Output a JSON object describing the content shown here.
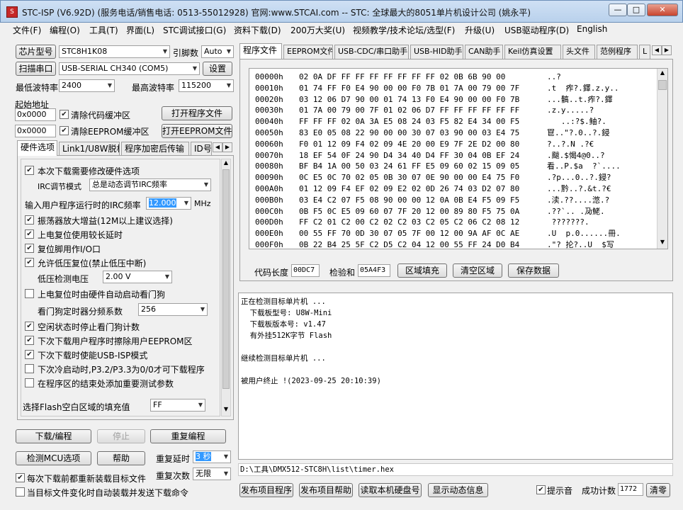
{
  "title": "STC-ISP (V6.92D) (服务电话/销售电话: 0513-55012928) 官网:www.STCAI.com  -- STC: 全球最大的8051单片机设计公司 (姚永平)",
  "window_buttons": {
    "minimize": "—",
    "maximize": "□",
    "close": "✕"
  },
  "menu": [
    "文件(F)",
    "编程(O)",
    "工具(T)",
    "界面(L)",
    "STC调试接口(G)",
    "资料下载(D)",
    "200万大奖(U)",
    "视频教学/技术论坛/选型(F)",
    "升级(U)",
    "USB驱动程序(D)",
    "English"
  ],
  "left": {
    "chip_btn": "芯片型号",
    "chip_value": "STC8H1K08",
    "pins_label": "引脚数",
    "pins_value": "Auto",
    "scan_btn": "扫描串口",
    "port_value": "USB-SERIAL CH340 (COM5)",
    "settings_btn": "设置",
    "min_baud_label": "最低波特率",
    "min_baud": "2400",
    "max_baud_label": "最高波特率",
    "max_baud": "115200",
    "start_addr_label": "起始地址",
    "addr1": "0x0000",
    "clear_code": "清除代码缓冲区",
    "open_prog": "打开程序文件",
    "addr2": "0x0000",
    "clear_eeprom": "清除EEPROM缓冲区",
    "open_eeprom": "打开EEPROM文件",
    "tabs": [
      "硬件选项",
      "Link1/U8W脱机",
      "程序加密后传输",
      "ID号"
    ],
    "hw": {
      "opt1": "本次下载需要修改硬件选项",
      "irc_mode_label": "IRC调节模式",
      "irc_mode": "总是动态调节IRC频率",
      "irc_freq_label": "输入用户程序运行时的IRC频率",
      "irc_freq": "12.000",
      "mhz": "MHz",
      "opt2": "振荡器放大增益(12M以上建议选择)",
      "opt3": "上电复位使用较长延时",
      "opt4": "复位脚用作I/O口",
      "opt5": "允许低压复位(禁止低压中断)",
      "lv_label": "低压检测电压",
      "lv_value": "2.00 V",
      "opt6": "上电复位时由硬件自动启动看门狗",
      "wdt_label": "看门狗定时器分频系数",
      "wdt_value": "256",
      "opt7": "空闲状态时停止看门狗计数",
      "opt8": "下次下载用户程序时擦除用户EEPROM区",
      "opt9": "下次下载时使能USB-ISP模式",
      "opt10": "下次冷启动时,P3.2/P3.3为0/0才可下载程序",
      "opt11": "在程序区的结束处添加重要测试参数",
      "fill_label": "选择Flash空白区域的填充值",
      "fill_value": "FF"
    },
    "download_btn": "下载/编程",
    "stop_btn": "停止",
    "reprog_btn": "重复编程",
    "detect_btn": "检测MCU选项",
    "help_btn": "帮助",
    "delay_label": "重复延时",
    "delay_value": "3 秒",
    "reload_label": "每次下载前都重新装载目标文件",
    "repeat_label": "重复次数",
    "repeat_value": "无限",
    "autoload_label": "当目标文件变化时自动装载并发送下载命令"
  },
  "right": {
    "tabs": [
      "程序文件",
      "EEPROM文件",
      "USB-CDC/串口助手",
      "USB-HID助手",
      "CAN助手",
      "Keil仿真设置",
      "头文件",
      "范例程序",
      "L"
    ],
    "hex_rows": [
      {
        "addr": "00000h",
        "bytes": "02 0A DF FF FF FF FF FF FF FF 02 0B 6B 90 00",
        "ascii": "..?"
      },
      {
        "addr": "00010h",
        "bytes": "01 74 FF F0 E4 90 00 00 F0 7B 01 7A 00 79 00 7F",
        "ascii": ".t  痄?.鐸.z.y.."
      },
      {
        "addr": "00020h",
        "bytes": "03 12 06 D7 90 00 01 74 13 F0 E4 90 00 00 F0 7B",
        "ascii": "...髇..t.痄?.鐸"
      },
      {
        "addr": "00030h",
        "bytes": "01 7A 00 79 00 7F 01 02 06 D7 FF FF FF FF FF FF",
        "ascii": ".z.y.....?"
      },
      {
        "addr": "00040h",
        "bytes": "FF FF FF 02 0A 3A E5 08 24 03 F5 82 E4 34 00 F5",
        "ascii": "   ..:?$.鲉?."
      },
      {
        "addr": "00050h",
        "bytes": "83 E0 05 08 22 90 00 00 30 07 03 90 00 03 E4 75",
        "ascii": "冟..\"?.0..?.鋟"
      },
      {
        "addr": "00060h",
        "bytes": "F0 01 12 09 F4 02 09 4E 20 00 E9 7F 2E D2 00 80",
        "ascii": "?..?.N .?€"
      },
      {
        "addr": "00070h",
        "bytes": "18 EF 54 0F 24 90 D4 34 40 D4 FF 30 04 0B EF 24",
        "ascii": ".颰.$愒4@0..?"
      },
      {
        "addr": "00080h",
        "bytes": "BF B4 1A 00 50 03 24 61 FF E5 09 60 02 15 09 05",
        "ascii": "看..P.$a  ?`...."
      },
      {
        "addr": "00090h",
        "bytes": "0C E5 0C 70 02 05 0B 30 07 0E 90 00 00 E4 75 F0",
        "ascii": ".?p...0..?.鋟?"
      },
      {
        "addr": "000A0h",
        "bytes": "01 12 09 F4 EF 02 09 E2 02 0D 26 74 03 D2 07 80",
        "ascii": "...黔..?.&t.?€"
      },
      {
        "addr": "000B0h",
        "bytes": "03 E4 C2 07 F5 08 90 00 00 12 0A 0B E4 F5 09 F5",
        "ascii": ".渎.??....滺.?"
      },
      {
        "addr": "000C0h",
        "bytes": "0B F5 0C E5 09 60 07 7F 20 12 00 89 80 F5 75 0A",
        "ascii": ".??`.. .夃鮱."
      },
      {
        "addr": "000D0h",
        "bytes": "FF C2 01 C2 00 C2 02 C2 03 C2 05 C2 06 C2 08 12",
        "ascii": " ???????."
      },
      {
        "addr": "000E0h",
        "bytes": "00 55 FF 70 0D 30 07 05 7F 00 12 00 9A AF 0C AE",
        "ascii": ".U  p.0......冊."
      },
      {
        "addr": "000F0h",
        "bytes": "0B 22 B4 25 5F C2 D5 C2 04 12 00 55 FF 24 D0 B4",
        "ascii": ".\"?_抡?..U  $写"
      }
    ],
    "code_len_label": "代码长度",
    "code_len": "00DC7",
    "checksum_label": "检验和",
    "checksum": "05A4F3",
    "fill_btn": "区域填充",
    "clear_btn": "清空区域",
    "save_btn": "保存数据",
    "log": [
      "正在检测目标单片机 ...",
      "  下载板型号: U8W-Mini",
      "  下载板版本号: v1.47",
      "  有外挂512K字节 Flash",
      "",
      "继续检测目标单片机 ...",
      "",
      "被用户终止 !(2023-09-25 20:10:39)"
    ],
    "path": "D:\\工具\\DMX512-STC8H\\list\\timer.hex",
    "publish_prog_btn": "发布项目程序",
    "publish_help_btn": "发布项目帮助",
    "read_disk_btn": "读取本机硬盘号",
    "show_info_btn": "显示动态信息",
    "tip_label": "提示音",
    "success_label": "成功计数",
    "success_count": "1772",
    "clear_count_btn": "清零"
  }
}
